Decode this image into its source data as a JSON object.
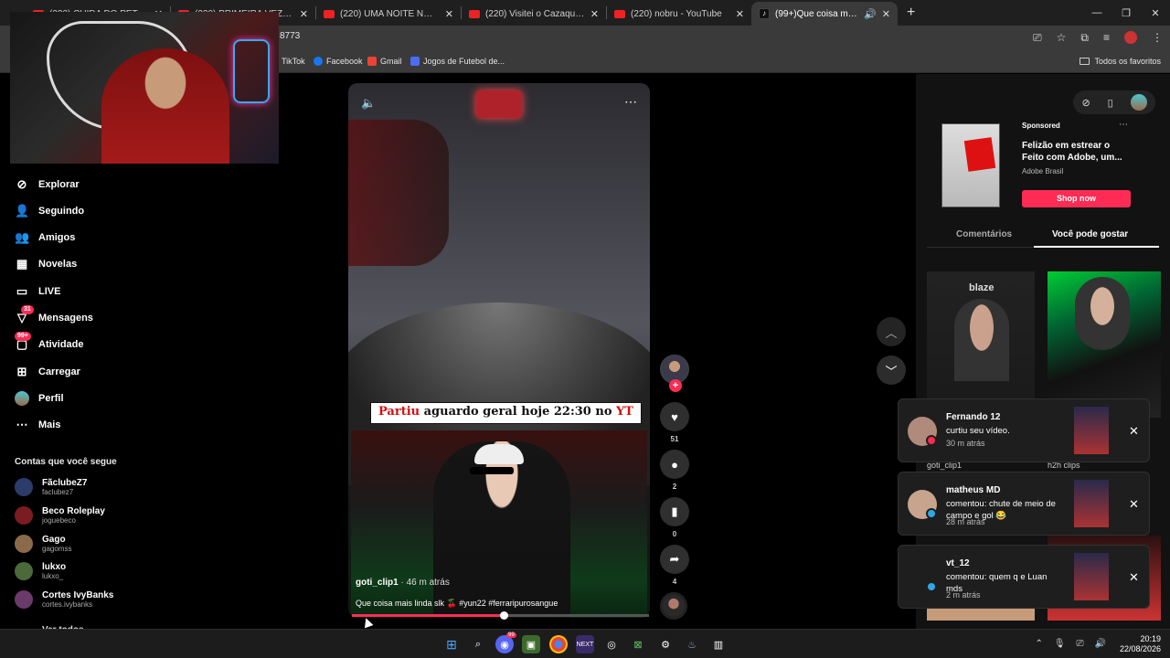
{
  "browser": {
    "tabs": [
      {
        "label": "(220) CUIDA DO PET - MC's Ne..."
      },
      {
        "label": "(220) PRIMEIRA VEZ FAZENDO..."
      },
      {
        "label": "(220) UMA NOITE NO LEILÃO D..."
      },
      {
        "label": "(220) Visitei o Cazaquistão (mi..."
      },
      {
        "label": "(220) nobru - YouTube"
      },
      {
        "label": "(99+)Que coisa mais linda s..."
      }
    ],
    "new_tab": "+",
    "url": "8773",
    "bookmarks": [
      {
        "label": "TikTok"
      },
      {
        "label": "Facebook"
      },
      {
        "label": "Gmail"
      },
      {
        "label": "Jogos de Futebol de..."
      }
    ],
    "all_bookmarks": "Todos os favoritos",
    "window_controls": [
      "—",
      "❐",
      "✕"
    ]
  },
  "nav": {
    "items": [
      {
        "label": "Explorar",
        "icon": "compass-icon"
      },
      {
        "label": "Seguindo",
        "icon": "person-icon"
      },
      {
        "label": "Amigos",
        "icon": "friends-icon"
      },
      {
        "label": "Novelas",
        "icon": "film-icon"
      },
      {
        "label": "LIVE",
        "icon": "live-icon"
      },
      {
        "label": "Mensagens",
        "icon": "send-icon",
        "badge": "31"
      },
      {
        "label": "Atividade",
        "icon": "inbox-icon",
        "badge": "99+"
      },
      {
        "label": "Carregar",
        "icon": "upload-icon"
      },
      {
        "label": "Perfil",
        "icon": "profile-avatar"
      },
      {
        "label": "Mais",
        "icon": "more-icon"
      }
    ],
    "following_header": "Contas que você segue",
    "accounts": [
      {
        "name": "FãclubeZ7",
        "handle": "faclubez7",
        "color": "#2b3c6a"
      },
      {
        "name": "Beco Roleplay",
        "handle": "joguebeco",
        "color": "#7a1c22"
      },
      {
        "name": "Gago",
        "handle": "gagomss",
        "color": "#8a6a4a"
      },
      {
        "name": "lukxo",
        "handle": "lukxo_",
        "color": "#4a6a3a"
      },
      {
        "name": "Cortes IvyBanks",
        "handle": "cortes.ivybanks",
        "color": "#6a3a6a"
      }
    ],
    "see_all": "Ver todos"
  },
  "video": {
    "overlay_caption_red": "Partiu",
    "overlay_caption_mid": "aguardo geral hoje 22:30 no",
    "overlay_caption_red2": "YT",
    "author": "goti_clip1",
    "time_ago": " · 46 m atrás",
    "description": "Que coisa mais linda slk 🍒 #yun22 #ferraripurosangue",
    "progress": 0.51
  },
  "actions": {
    "likes": "51",
    "comments": "2",
    "saves": "0",
    "shares": "4"
  },
  "right_panel": {
    "ad": {
      "sponsored": "Sponsored",
      "title": "Felizão em estrear o Feito com Adobe, um...",
      "brand": "Adobe Brasil",
      "cta": "Shop now"
    },
    "tabs": {
      "comments": "Comentários",
      "you_may_like": "Você pode gostar"
    },
    "thumb_labels": [
      "goti_clip1",
      "h2h clips"
    ],
    "thumb1_logo": "blaze"
  },
  "notifications": [
    {
      "name": "Fernando 12",
      "message": "curtiu seu vídeo.",
      "time": "30 m atrás",
      "avatar_color": "#b08a7a",
      "mini_color": "#fe2c55"
    },
    {
      "name": "matheus MD",
      "message": "comentou: chute de meio de campo e gol 😂",
      "time": "28 m atrás",
      "avatar_color": "#c8a48c",
      "mini_color": "#2ea8e6"
    },
    {
      "name": "vt_12",
      "message": "comentou: quem q e Luan mds",
      "time": "2 m atrás",
      "avatar_color": "#1e1e1e",
      "mini_color": "#2ea8e6"
    }
  ],
  "taskbar": {
    "apps": [
      "windows",
      "search",
      "discord",
      "app",
      "chrome",
      "next",
      "steamlike",
      "xbox",
      "settings",
      "steam",
      "app2"
    ],
    "discord_badge": "99",
    "time": "20:19",
    "date": "22/08/2026"
  }
}
